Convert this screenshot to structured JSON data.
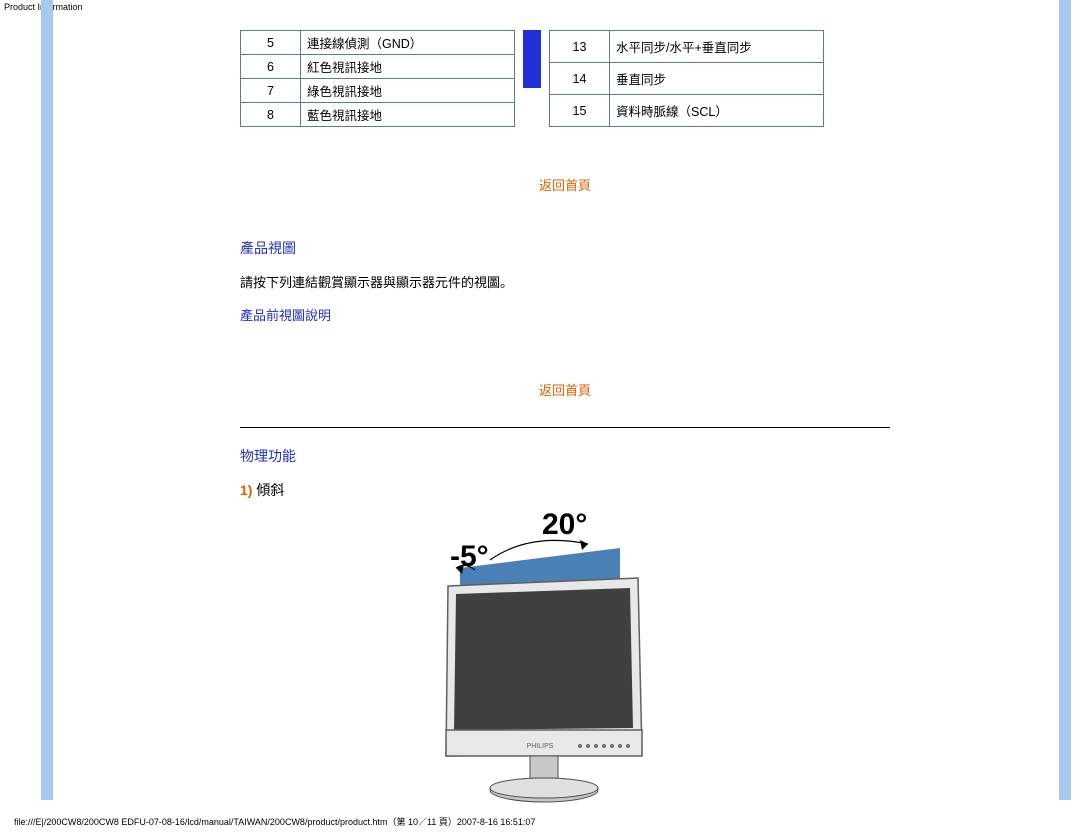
{
  "page_header": "Product Information",
  "pin_left": [
    {
      "n": "5",
      "d": "連接線偵測（GND）"
    },
    {
      "n": "6",
      "d": "紅色視訊接地"
    },
    {
      "n": "7",
      "d": "綠色視訊接地"
    },
    {
      "n": "8",
      "d": "藍色視訊接地"
    }
  ],
  "pin_right": [
    {
      "n": "13",
      "d": "水平同步/水平+垂直同步"
    },
    {
      "n": "14",
      "d": "垂直同步"
    },
    {
      "n": "15",
      "d": "資料時脈線（SCL）"
    }
  ],
  "back_to_top": "返回首頁",
  "section_views": "產品視圖",
  "views_text": "請按下列連結觀賞顯示器與顯示器元件的視圖。",
  "front_view_link": "產品前視圖說明",
  "section_phys": "物理功能",
  "tilt_num": "1)",
  "tilt_label": "傾斜",
  "deg20": "20°",
  "degm5": "-5°",
  "footer": "file:///E|/200CW8/200CW8 EDFU-07-08-16/lcd/manual/TAIWAN/200CW8/product/product.htm（第 10／11 頁）2007-8-16 16:51:07"
}
